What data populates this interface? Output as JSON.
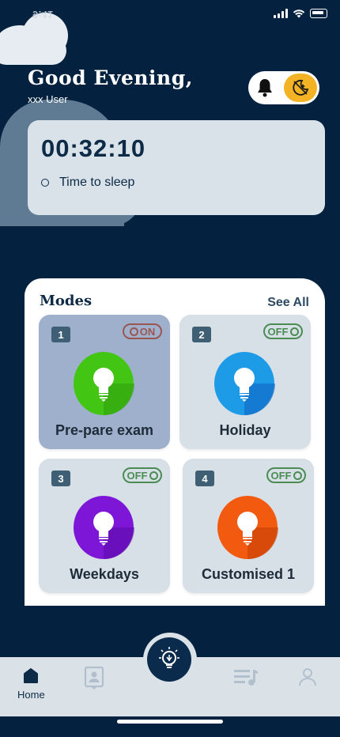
{
  "status": {
    "time": "9:41"
  },
  "header": {
    "greeting": "Good Evening,",
    "username": "xxx User"
  },
  "timer": {
    "value": "00:32:10",
    "label": "Time to sleep"
  },
  "modes": {
    "title": "Modes",
    "see_all": "See All",
    "items": [
      {
        "number": "1",
        "label": "Pre-pare exam",
        "state": "ON",
        "bulb_color": "#43c514",
        "active": true
      },
      {
        "number": "2",
        "label": "Holiday",
        "state": "OFF",
        "bulb_color": "#1e9be6",
        "active": false
      },
      {
        "number": "3",
        "label": "Weekdays",
        "state": "OFF",
        "bulb_color": "#7d16d6",
        "active": false
      },
      {
        "number": "4",
        "label": "Customised 1",
        "state": "OFF",
        "bulb_color": "#f25a10",
        "active": false
      }
    ]
  },
  "nav": {
    "home_label": "Home",
    "icons": [
      "home-icon",
      "profile-card-icon",
      "bulb-icon",
      "playlist-icon",
      "user-icon"
    ]
  },
  "colors": {
    "background": "#04223f",
    "accent": "#f3b324",
    "card": "#d7e0e6",
    "active_card": "#9fb0cd",
    "switch_off": "#4b8c53",
    "switch_on": "#9a5651"
  }
}
